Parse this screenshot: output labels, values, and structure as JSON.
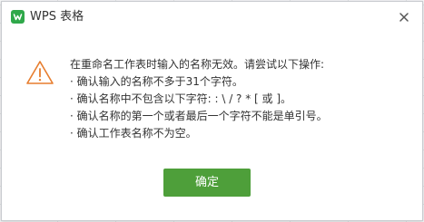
{
  "dialog": {
    "app_icon": "wps-logo-icon",
    "title": "WPS 表格",
    "close_icon": "close-icon",
    "warning_icon": "warning-triangle-icon",
    "message_lines": [
      "在重命名工作表时输入的名称无效。请尝试以下操作:",
      "· 确认输入的名称不多于31个字符。",
      "· 确认名称中不包含以下字符: : \\ / ? * [ 或 ]。",
      "· 确认名称的第一个或者最后一个字符不能是单引号。",
      "· 确认工作表名称不为空。"
    ],
    "ok_label": "确定"
  },
  "colors": {
    "ok_button": "#4e9f3a",
    "warning": "#e77d2e",
    "logo": "#2fa84a"
  }
}
